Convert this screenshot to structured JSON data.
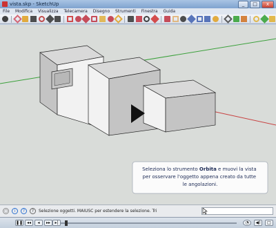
{
  "window": {
    "title": "vista.skp - SketchUp"
  },
  "titlebar_buttons": [
    "_",
    "□",
    "x"
  ],
  "menu": [
    "File",
    "Modifica",
    "Visualizza",
    "Telecamera",
    "Disegno",
    "Strumenti",
    "Finestra",
    "Guida"
  ],
  "toolbar": {
    "tools": [
      {
        "name": "select-tool-icon",
        "color": "#222222"
      },
      {
        "name": "eraser-tool-icon",
        "color": "#d05060"
      },
      {
        "name": "pencil-tool-icon",
        "color": "#e0a020"
      },
      {
        "name": "rectangle-tool-icon",
        "color": "#333333"
      },
      {
        "name": "circle-tool-icon",
        "color": "#ba3030"
      },
      {
        "name": "arc-tool-icon",
        "color": "#333333"
      },
      {
        "name": "polygon-tool-icon",
        "color": "#333333"
      },
      {
        "name": "pushpull-tool-icon",
        "color": "#cc3030"
      },
      {
        "name": "move-tool-icon",
        "color": "#c03040"
      },
      {
        "name": "rotate-tool-icon",
        "color": "#c03040"
      },
      {
        "name": "offset-tool-icon",
        "color": "#c03040"
      },
      {
        "name": "tape-measure-icon",
        "color": "#e0b040"
      },
      {
        "name": "dimension-tool-icon",
        "color": "#c03040"
      },
      {
        "name": "protractor-tool-icon",
        "color": "#e0a020"
      },
      {
        "name": "text-tool-icon",
        "color": "#333333"
      },
      {
        "name": "axes-tool-icon",
        "color": "#c03040"
      },
      {
        "name": "3d-text-tool-icon",
        "color": "#222222"
      },
      {
        "name": "paint-bucket-icon",
        "color": "#d03030"
      },
      {
        "name": "orbit-tool-icon",
        "color": "#c03040"
      },
      {
        "name": "pan-tool-icon",
        "color": "#e0b070"
      },
      {
        "name": "zoom-tool-icon",
        "color": "#303030"
      },
      {
        "name": "zoom-extents-icon",
        "color": "#4060b0"
      },
      {
        "name": "previous-view-icon",
        "color": "#4060b0"
      },
      {
        "name": "next-view-icon",
        "color": "#4060b0"
      },
      {
        "name": "position-camera-icon",
        "color": "#e0a020"
      },
      {
        "name": "walk-tool-icon",
        "color": "#404040"
      },
      {
        "name": "look-around-icon",
        "color": "#30a030"
      },
      {
        "name": "section-plane-icon",
        "color": "#d07020"
      },
      {
        "name": "component-icon",
        "color": "#e0b030"
      },
      {
        "name": "warehouse-icon",
        "color": "#30a030"
      },
      {
        "name": "extension-icon",
        "color": "#e0b030"
      }
    ]
  },
  "scene": {
    "tooltip_before": "Seleziona lo strumento ",
    "tooltip_bold": "Orbita",
    "tooltip_after": " e muovi la vista per osservare l'oggetto appena creato da tutte le angolazioni.",
    "colors": {
      "sky": "#d9dcd9",
      "green_axis": "#3aa03a",
      "red_axis": "#c84040",
      "top_face": "#d9d9d9",
      "front_face": "#f2f2f2",
      "side_face": "#c4c4c4"
    }
  },
  "status": {
    "text": "Selezione oggetti. MAIUSC per estendere la selezione. Tri"
  },
  "player": {
    "buttons": [
      "pause",
      "prev",
      "rewind",
      "forward",
      "next"
    ]
  }
}
